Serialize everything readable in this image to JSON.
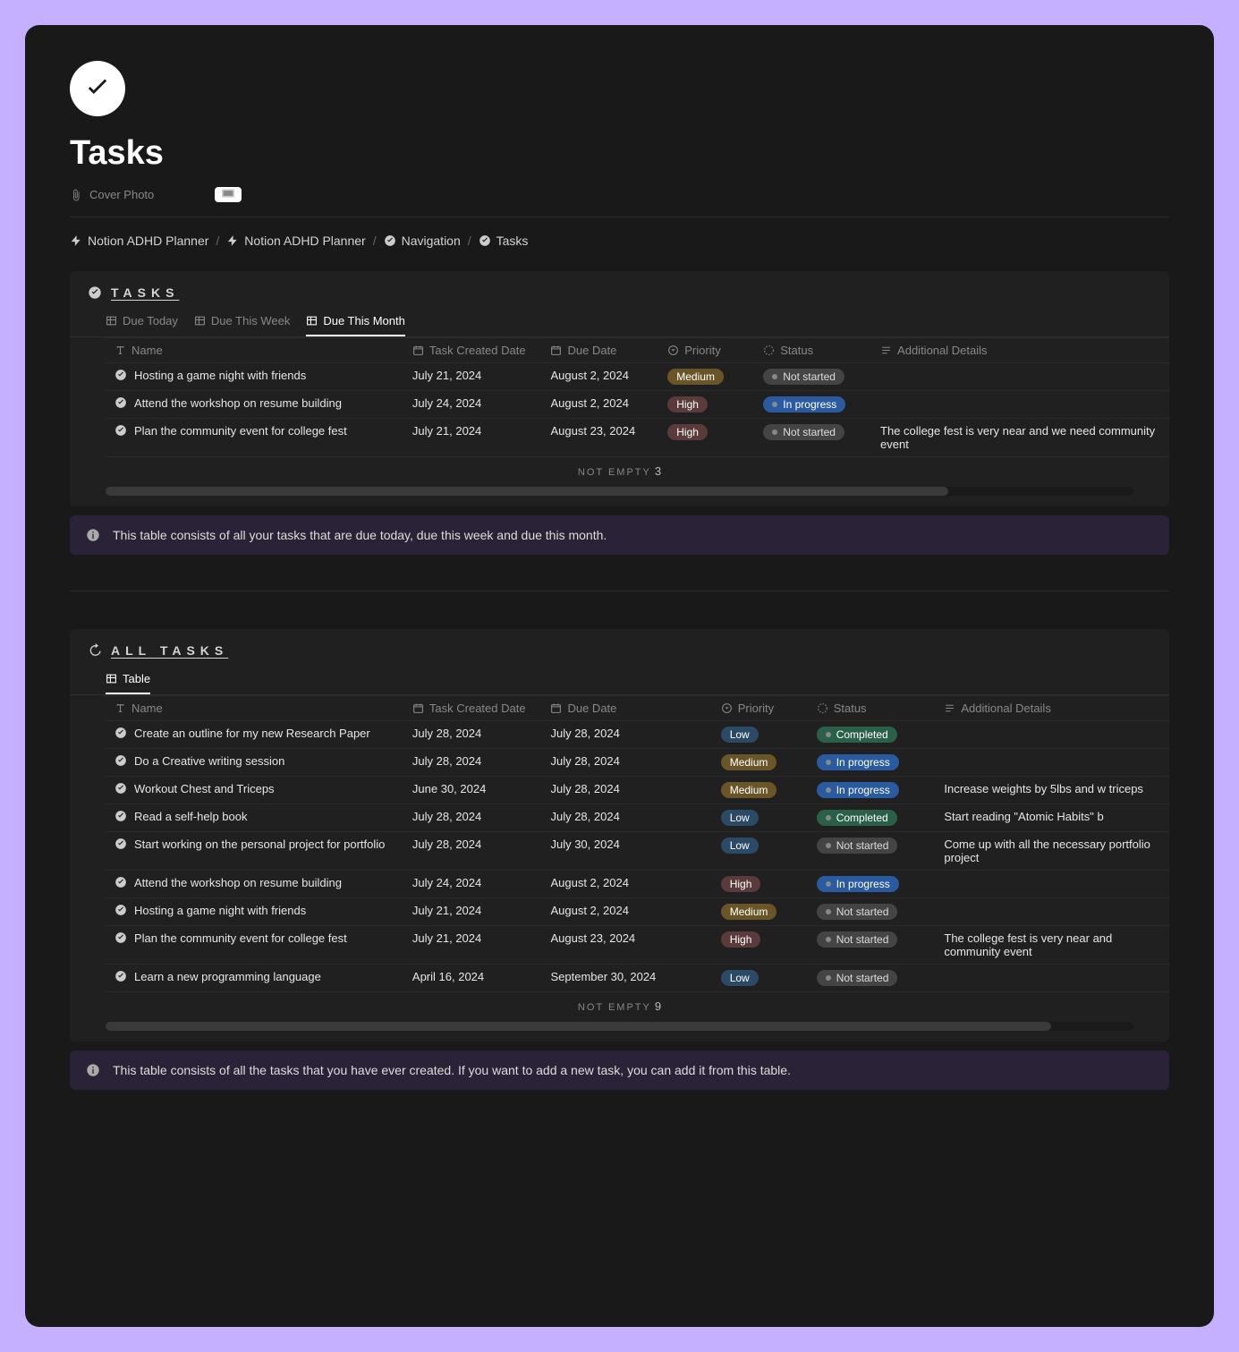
{
  "page": {
    "title": "Tasks",
    "cover_label": "Cover Photo"
  },
  "breadcrumb": [
    {
      "icon": "bolt",
      "label": "Notion ADHD Planner"
    },
    {
      "icon": "bolt",
      "label": "Notion ADHD Planner"
    },
    {
      "icon": "check-badge",
      "label": "Navigation"
    },
    {
      "icon": "check-badge",
      "label": "Tasks"
    }
  ],
  "tasks_block": {
    "title": "TASKS",
    "tabs": [
      {
        "label": "Due Today",
        "active": false
      },
      {
        "label": "Due This Week",
        "active": false
      },
      {
        "label": "Due This Month",
        "active": true
      }
    ],
    "columns": {
      "name": "Name",
      "created": "Task Created Date",
      "due": "Due Date",
      "priority": "Priority",
      "status": "Status",
      "details": "Additional Details"
    },
    "rows": [
      {
        "name": "Hosting a game night with friends",
        "created": "July 21, 2024",
        "due": "August 2, 2024",
        "priority": "Medium",
        "status": "Not started",
        "details": ""
      },
      {
        "name": "Attend the workshop on resume building",
        "created": "July 24, 2024",
        "due": "August 2, 2024",
        "priority": "High",
        "status": "In progress",
        "details": ""
      },
      {
        "name": "Plan the community event for college fest",
        "created": "July 21, 2024",
        "due": "August 23, 2024",
        "priority": "High",
        "status": "Not started",
        "details": "The college fest is very near and we need community event"
      }
    ],
    "summary_label": "NOT EMPTY",
    "summary_count": "3",
    "callout": "This table consists of all your tasks that are due today, due this week and due this month."
  },
  "all_tasks_block": {
    "title": "ALL TASKS",
    "tab_label": "Table",
    "columns": {
      "name": "Name",
      "created": "Task Created Date",
      "due": "Due Date",
      "priority": "Priority",
      "status": "Status",
      "details": "Additional Details"
    },
    "rows": [
      {
        "name": "Create an outline for my new Research Paper",
        "created": "July 28, 2024",
        "due": "July 28, 2024",
        "priority": "Low",
        "status": "Completed",
        "details": ""
      },
      {
        "name": "Do a Creative writing session",
        "created": "July 28, 2024",
        "due": "July 28, 2024",
        "priority": "Medium",
        "status": "In progress",
        "details": ""
      },
      {
        "name": "Workout Chest and Triceps",
        "created": "June 30, 2024",
        "due": "July 28, 2024",
        "priority": "Medium",
        "status": "In progress",
        "details": "Increase weights by 5lbs and w triceps"
      },
      {
        "name": "Read a self-help book",
        "created": "July 28, 2024",
        "due": "July 28, 2024",
        "priority": "Low",
        "status": "Completed",
        "details": "Start reading \"Atomic Habits\" b"
      },
      {
        "name": "Start working on the personal project for portfolio",
        "created": "July 28, 2024",
        "due": "July 30, 2024",
        "priority": "Low",
        "status": "Not started",
        "details": "Come up with all the necessary portfolio project"
      },
      {
        "name": "Attend the workshop on resume building",
        "created": "July 24, 2024",
        "due": "August 2, 2024",
        "priority": "High",
        "status": "In progress",
        "details": ""
      },
      {
        "name": "Hosting a game night with friends",
        "created": "July 21, 2024",
        "due": "August 2, 2024",
        "priority": "Medium",
        "status": "Not started",
        "details": ""
      },
      {
        "name": "Plan the community event for college fest",
        "created": "July 21, 2024",
        "due": "August 23, 2024",
        "priority": "High",
        "status": "Not started",
        "details": "The college fest is very near and community event"
      },
      {
        "name": "Learn a new programming language",
        "created": "April 16, 2024",
        "due": "September 30, 2024",
        "priority": "Low",
        "status": "Not started",
        "details": ""
      }
    ],
    "summary_label": "NOT EMPTY",
    "summary_count": "9",
    "callout": "This table consists of all the tasks that you have ever created. If you want to add a new task, you can add it from this table."
  },
  "priority_class": {
    "High": "p-high",
    "Medium": "p-medium",
    "Low": "p-low"
  },
  "status_class": {
    "Not started": "s-notstarted",
    "In progress": "s-inprogress",
    "Completed": "s-completed"
  }
}
